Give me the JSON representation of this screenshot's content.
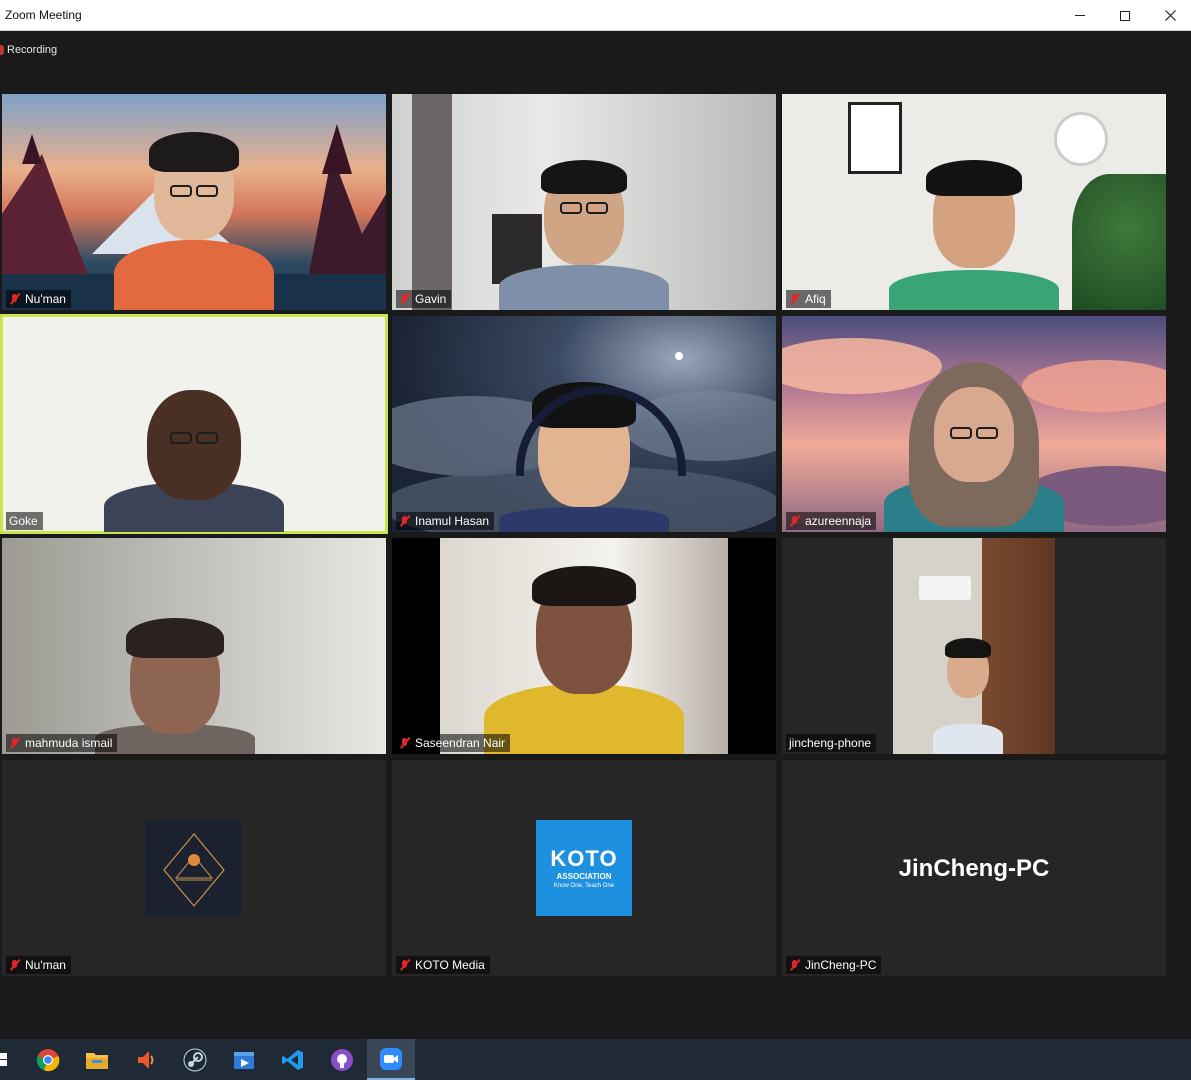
{
  "window": {
    "title": "Zoom Meeting",
    "controls": [
      "minimize",
      "maximize",
      "close"
    ]
  },
  "meeting": {
    "recording_label": "Recording",
    "participants": [
      {
        "name": "Nu'man",
        "muted": true,
        "video": true
      },
      {
        "name": "Gavin",
        "muted": true,
        "video": true
      },
      {
        "name": "Afiq",
        "muted": true,
        "video": true
      },
      {
        "name": "Goke",
        "muted": false,
        "video": true,
        "active_speaker": true
      },
      {
        "name": "Inamul Hasan",
        "muted": true,
        "video": true
      },
      {
        "name": "azureennaja",
        "muted": true,
        "video": true
      },
      {
        "name": "mahmuda ismail",
        "muted": true,
        "video": true
      },
      {
        "name": "Saseendran Nair",
        "muted": true,
        "video": true
      },
      {
        "name": "jincheng-phone",
        "muted": false,
        "video": true
      },
      {
        "name": "Nu'man",
        "muted": true,
        "video": false,
        "avatar": "mountain-logo"
      },
      {
        "name": "KOTO Media",
        "muted": true,
        "video": false,
        "avatar": "koto-logo"
      },
      {
        "name": "JinCheng-PC",
        "muted": true,
        "video": false,
        "display_name": "JinCheng-PC"
      }
    ]
  },
  "koto_logo": {
    "line1": "KOTO",
    "line2": "ASSOCIATION",
    "line3": "Know One, Teach One"
  },
  "taskbar": {
    "items": [
      "windows-start",
      "chrome",
      "file-explorer",
      "audio-app",
      "steam",
      "video-editor",
      "vscode",
      "github-desktop",
      "zoom"
    ],
    "active": "zoom"
  },
  "colors": {
    "active_speaker_border": "#c8e64b",
    "muted_icon": "#e02828",
    "koto_blue": "#1e90e0",
    "taskbar": "#1f2a36"
  }
}
